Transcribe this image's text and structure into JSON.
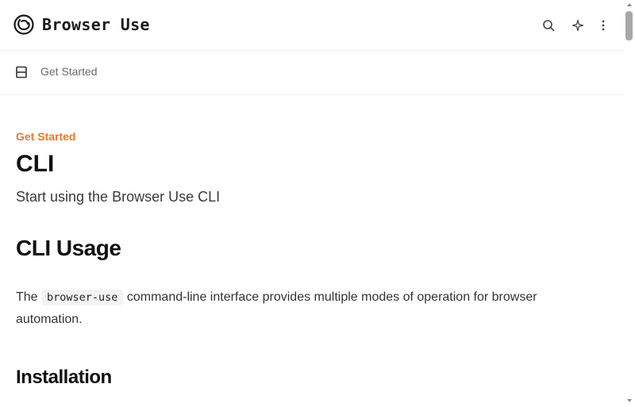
{
  "header": {
    "brand": "Browser Use",
    "logo_icon": "browser-use-logo-icon",
    "search_icon": "search-icon",
    "ai_icon": "sparkle-icon",
    "more_icon": "more-vertical-icon"
  },
  "subbar": {
    "menu_icon": "menu-icon",
    "breadcrumb": "Get Started"
  },
  "content": {
    "eyebrow": "Get Started",
    "title": "CLI",
    "subtitle": "Start using the Browser Use CLI",
    "section1_heading": "CLI Usage",
    "para_before": "The ",
    "para_code": "browser-use",
    "para_after": " command-line interface provides multiple modes of operation for browser automation.",
    "section2_heading": "Installation"
  },
  "colors": {
    "accent": "#e8792b",
    "text": "#111111",
    "scrollbar": "#a8a8a8"
  }
}
